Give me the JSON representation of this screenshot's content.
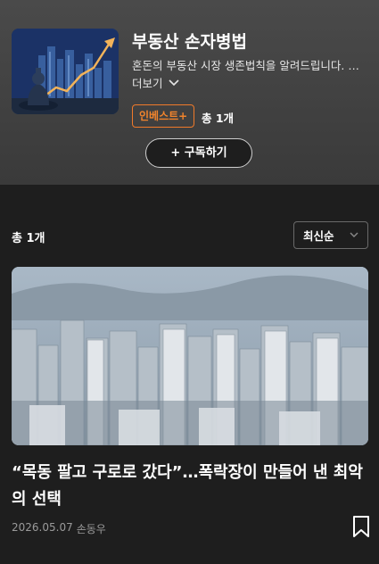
{
  "series": {
    "title": "부동산 손자병법",
    "description": "혼돈의 부동산 시장 생존법칙을 알려드립니다. 부동산 시장을 꿰뚫는 시각을 전합니다.",
    "more_label": "더보기",
    "badge": "인베스트+",
    "count": "총 1개",
    "subscribe_label": "+ 구독하기"
  },
  "list": {
    "count": "총 1개",
    "sort_label": "최신순"
  },
  "article": {
    "headline": "“목동 팔고 구로로 갔다”…폭락장이 만들어 낸 최악의 선택",
    "date": "2026.05.07",
    "author": "손동우"
  },
  "colors": {
    "background": "#1e1e1e",
    "header": "#3f3f3f",
    "accent": "#f07a2a"
  },
  "icons": {
    "more": "chevron-down-icon",
    "sort": "chevron-down-icon",
    "bookmark": "bookmark-icon"
  }
}
